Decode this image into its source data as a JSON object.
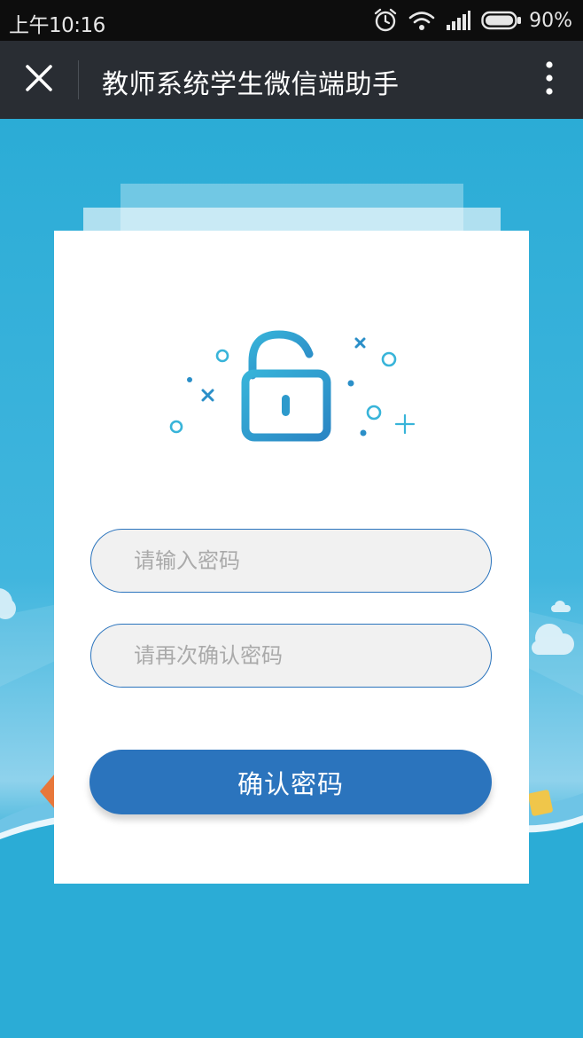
{
  "status_bar": {
    "time": "上午10:16",
    "battery_percent": "90%",
    "icons": [
      "alarm-icon",
      "wifi-icon",
      "signal-icon",
      "battery-icon"
    ]
  },
  "title_bar": {
    "title": "教师系统学生微信端助手",
    "close_icon": "close-icon",
    "more_icon": "more-vertical-icon"
  },
  "form": {
    "password_placeholder": "请输入密码",
    "password_value": "",
    "confirm_placeholder": "请再次确认密码",
    "confirm_value": "",
    "submit_label": "确认密码"
  },
  "illustration": {
    "icon": "unlocked-padlock-icon"
  },
  "colors": {
    "background": "#2bacd6",
    "title_bar": "#292d33",
    "status_bar": "#0d0d0d",
    "accent": "#2b74bd",
    "input_fill": "#f1f1f1"
  }
}
